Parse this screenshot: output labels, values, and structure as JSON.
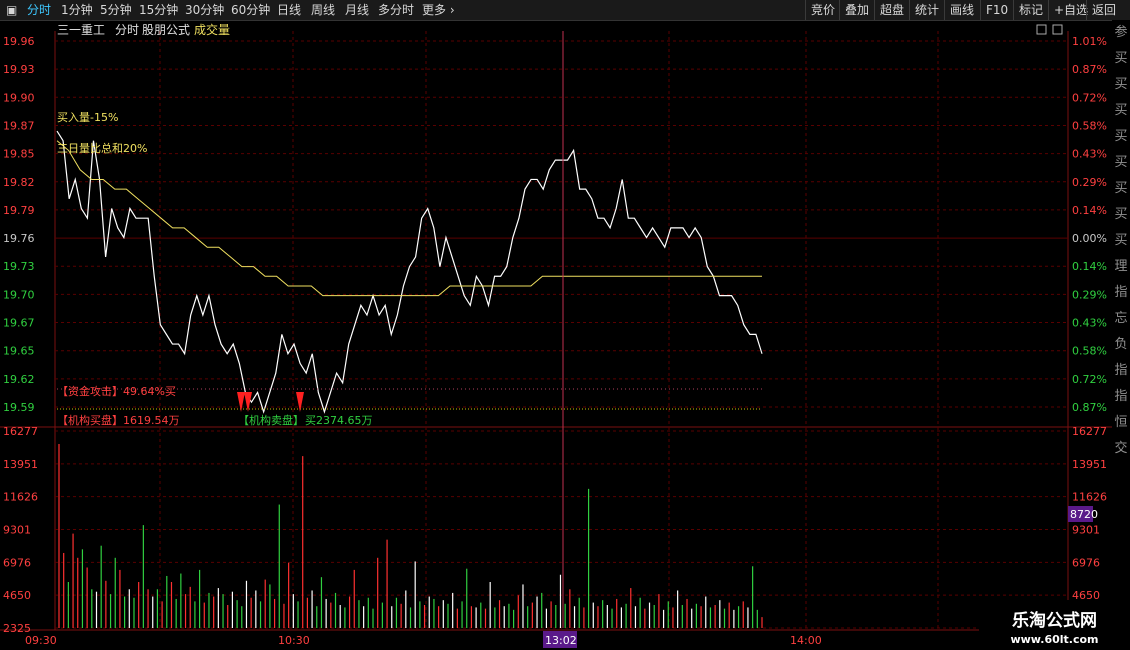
{
  "toolbar": {
    "tabs": [
      "分时",
      "1分钟",
      "5分钟",
      "15分钟",
      "30分钟",
      "60分钟",
      "日线",
      "周线",
      "月线",
      "多分时",
      "更多"
    ],
    "active_tab": "分时",
    "buttons": [
      "竞价",
      "叠加",
      "超盘",
      "统计",
      "画线",
      "F10",
      "标记",
      "+自选",
      "返回"
    ]
  },
  "header": {
    "stock_name": "三一重工",
    "mode": "分时",
    "formula": "股朋公式",
    "indicator": "成交量"
  },
  "annotations": {
    "buy_volume": "买入量-15%",
    "three_day": "三日量比总和20%",
    "capital_attack": "【资金攻击】49.64%买",
    "institution_buy": "【机构买盘】1619.54万",
    "institution_sell": "【机构卖盘】",
    "sell_value": "买2374.65万"
  },
  "volume_highlight": "8720",
  "time_cursor": "13:02",
  "watermark": {
    "title": "乐淘公式网",
    "url": "www.60lt.com"
  },
  "side_text": [
    "参",
    "买",
    "买",
    "买",
    "买",
    "买",
    "买",
    "买",
    "买",
    "理",
    "指",
    "忘",
    "负",
    "指",
    "指",
    "恒",
    "交"
  ],
  "chart_data": {
    "type": "line",
    "price_axis": [
      "19.96",
      "19.93",
      "19.90",
      "19.87",
      "19.85",
      "19.82",
      "19.79",
      "19.76",
      "19.73",
      "19.70",
      "19.67",
      "19.65",
      "19.62",
      "19.59"
    ],
    "pct_axis": [
      "1.01%",
      "0.87%",
      "0.72%",
      "0.58%",
      "0.43%",
      "0.29%",
      "0.14%",
      "0.00%",
      "0.14%",
      "0.29%",
      "0.43%",
      "0.58%",
      "0.72%",
      "0.87%"
    ],
    "price_range": [
      19.585,
      19.963
    ],
    "volume_axis": [
      "16277",
      "13951",
      "11626",
      "9301",
      "6976",
      "4650",
      "2325"
    ],
    "volume_max": 16277,
    "time_ticks": [
      "09:30",
      "10:30",
      "13:02",
      "14:00"
    ],
    "price_series": [
      19.87,
      19.86,
      19.8,
      19.82,
      19.79,
      19.78,
      19.86,
      19.82,
      19.74,
      19.79,
      19.77,
      19.76,
      19.79,
      19.78,
      19.78,
      19.78,
      19.72,
      19.67,
      19.66,
      19.65,
      19.65,
      19.64,
      19.68,
      19.7,
      19.68,
      19.7,
      19.67,
      19.65,
      19.64,
      19.65,
      19.63,
      19.6,
      19.59,
      19.6,
      19.58,
      19.6,
      19.62,
      19.66,
      19.64,
      19.65,
      19.63,
      19.62,
      19.64,
      19.6,
      19.58,
      19.6,
      19.62,
      19.61,
      19.65,
      19.67,
      19.69,
      19.68,
      19.7,
      19.68,
      19.69,
      19.66,
      19.68,
      19.71,
      19.73,
      19.74,
      19.78,
      19.79,
      19.77,
      19.73,
      19.76,
      19.74,
      19.72,
      19.7,
      19.69,
      19.72,
      19.71,
      19.69,
      19.72,
      19.72,
      19.73,
      19.76,
      19.78,
      19.81,
      19.82,
      19.82,
      19.81,
      19.83,
      19.84,
      19.84,
      19.84,
      19.85,
      19.81,
      19.81,
      19.8,
      19.78,
      19.78,
      19.77,
      19.79,
      19.82,
      19.78,
      19.78,
      19.77,
      19.76,
      19.77,
      19.76,
      19.75,
      19.77,
      19.77,
      19.77,
      19.76,
      19.77,
      19.76,
      19.73,
      19.72,
      19.7,
      19.7,
      19.7,
      19.69,
      19.67,
      19.66,
      19.66,
      19.64
    ],
    "avg_series": [
      19.86,
      19.85,
      19.83,
      19.82,
      19.82,
      19.81,
      19.81,
      19.8,
      19.79,
      19.78,
      19.77,
      19.77,
      19.76,
      19.75,
      19.75,
      19.74,
      19.73,
      19.73,
      19.72,
      19.72,
      19.71,
      19.71,
      19.71,
      19.7,
      19.7,
      19.7,
      19.7,
      19.7,
      19.7,
      19.7,
      19.7,
      19.7,
      19.7,
      19.7,
      19.71,
      19.71,
      19.71,
      19.71,
      19.71,
      19.71,
      19.71,
      19.71,
      19.72,
      19.72,
      19.72,
      19.72,
      19.72,
      19.72,
      19.72,
      19.72,
      19.72,
      19.72,
      19.72,
      19.72,
      19.72,
      19.72,
      19.72,
      19.72,
      19.72,
      19.72,
      19.72,
      19.72
    ],
    "volume_series": [
      [
        15200,
        "r"
      ],
      [
        6200,
        "r"
      ],
      [
        3800,
        "g"
      ],
      [
        7800,
        "r"
      ],
      [
        5800,
        "r"
      ],
      [
        6500,
        "g"
      ],
      [
        5000,
        "r"
      ],
      [
        3200,
        "g"
      ],
      [
        3000,
        "w"
      ],
      [
        6800,
        "g"
      ],
      [
        3900,
        "r"
      ],
      [
        2800,
        "g"
      ],
      [
        5800,
        "g"
      ],
      [
        4800,
        "r"
      ],
      [
        2600,
        "g"
      ],
      [
        3200,
        "w"
      ],
      [
        2500,
        "g"
      ],
      [
        3800,
        "r"
      ],
      [
        8500,
        "g"
      ],
      [
        3200,
        "r"
      ],
      [
        2600,
        "w"
      ],
      [
        3200,
        "g"
      ],
      [
        2200,
        "r"
      ],
      [
        4300,
        "g"
      ],
      [
        3800,
        "r"
      ],
      [
        2400,
        "g"
      ],
      [
        4500,
        "g"
      ],
      [
        2800,
        "r"
      ],
      [
        3400,
        "r"
      ],
      [
        2200,
        "g"
      ],
      [
        4800,
        "g"
      ],
      [
        2100,
        "r"
      ],
      [
        2900,
        "g"
      ],
      [
        2600,
        "r"
      ],
      [
        3300,
        "w"
      ],
      [
        2800,
        "g"
      ],
      [
        1900,
        "r"
      ],
      [
        3000,
        "w"
      ],
      [
        2300,
        "g"
      ],
      [
        1800,
        "g"
      ],
      [
        3900,
        "w"
      ],
      [
        2500,
        "r"
      ],
      [
        3100,
        "w"
      ],
      [
        2200,
        "g"
      ],
      [
        4000,
        "r"
      ],
      [
        3600,
        "g"
      ],
      [
        2400,
        "r"
      ],
      [
        10200,
        "g"
      ],
      [
        2000,
        "r"
      ],
      [
        5400,
        "r"
      ],
      [
        2800,
        "w"
      ],
      [
        2200,
        "g"
      ],
      [
        14200,
        "r"
      ],
      [
        2500,
        "r"
      ],
      [
        3100,
        "w"
      ],
      [
        1800,
        "g"
      ],
      [
        4200,
        "g"
      ],
      [
        2400,
        "w"
      ],
      [
        2100,
        "r"
      ],
      [
        2900,
        "g"
      ],
      [
        1900,
        "w"
      ],
      [
        1700,
        "g"
      ],
      [
        2600,
        "r"
      ],
      [
        4800,
        "r"
      ],
      [
        2300,
        "g"
      ],
      [
        1800,
        "w"
      ],
      [
        2500,
        "g"
      ],
      [
        1600,
        "g"
      ],
      [
        5800,
        "r"
      ],
      [
        2100,
        "g"
      ],
      [
        7300,
        "r"
      ],
      [
        1800,
        "w"
      ],
      [
        2500,
        "g"
      ],
      [
        2000,
        "r"
      ],
      [
        3100,
        "w"
      ],
      [
        1700,
        "g"
      ],
      [
        5500,
        "w"
      ],
      [
        2200,
        "g"
      ],
      [
        1900,
        "r"
      ],
      [
        2600,
        "w"
      ],
      [
        2400,
        "g"
      ],
      [
        1800,
        "r"
      ],
      [
        2300,
        "w"
      ],
      [
        2000,
        "g"
      ],
      [
        2900,
        "w"
      ],
      [
        1600,
        "r"
      ],
      [
        2200,
        "g"
      ],
      [
        4900,
        "g"
      ],
      [
        1800,
        "r"
      ],
      [
        1700,
        "w"
      ],
      [
        2100,
        "g"
      ],
      [
        1600,
        "r"
      ],
      [
        3800,
        "w"
      ],
      [
        1700,
        "g"
      ],
      [
        2300,
        "r"
      ],
      [
        1800,
        "w"
      ],
      [
        2000,
        "g"
      ],
      [
        1500,
        "g"
      ],
      [
        2700,
        "r"
      ],
      [
        3600,
        "w"
      ],
      [
        1800,
        "g"
      ],
      [
        2100,
        "r"
      ],
      [
        2600,
        "w"
      ],
      [
        2900,
        "g"
      ],
      [
        1600,
        "w"
      ],
      [
        2200,
        "r"
      ],
      [
        1900,
        "g"
      ],
      [
        4400,
        "w"
      ],
      [
        2000,
        "g"
      ],
      [
        3200,
        "r"
      ],
      [
        1800,
        "w"
      ],
      [
        2500,
        "g"
      ],
      [
        1700,
        "r"
      ],
      [
        11500,
        "g"
      ],
      [
        2100,
        "w"
      ],
      [
        1800,
        "r"
      ],
      [
        2300,
        "g"
      ],
      [
        1900,
        "w"
      ],
      [
        1600,
        "g"
      ],
      [
        2400,
        "r"
      ],
      [
        1700,
        "w"
      ],
      [
        2000,
        "g"
      ],
      [
        3300,
        "r"
      ],
      [
        1800,
        "w"
      ],
      [
        2500,
        "g"
      ],
      [
        1600,
        "r"
      ],
      [
        2100,
        "w"
      ],
      [
        1900,
        "g"
      ],
      [
        2800,
        "r"
      ],
      [
        1500,
        "w"
      ],
      [
        2200,
        "g"
      ],
      [
        1700,
        "r"
      ],
      [
        3100,
        "w"
      ],
      [
        1900,
        "g"
      ],
      [
        2400,
        "r"
      ],
      [
        1600,
        "w"
      ],
      [
        2000,
        "g"
      ],
      [
        1800,
        "r"
      ],
      [
        2600,
        "w"
      ],
      [
        1700,
        "g"
      ],
      [
        1900,
        "r"
      ],
      [
        2300,
        "w"
      ],
      [
        1600,
        "g"
      ],
      [
        2100,
        "r"
      ],
      [
        1500,
        "w"
      ],
      [
        1800,
        "g"
      ],
      [
        2200,
        "r"
      ],
      [
        1700,
        "w"
      ],
      [
        5100,
        "g"
      ],
      [
        1500,
        "g"
      ],
      [
        900,
        "r"
      ]
    ]
  }
}
